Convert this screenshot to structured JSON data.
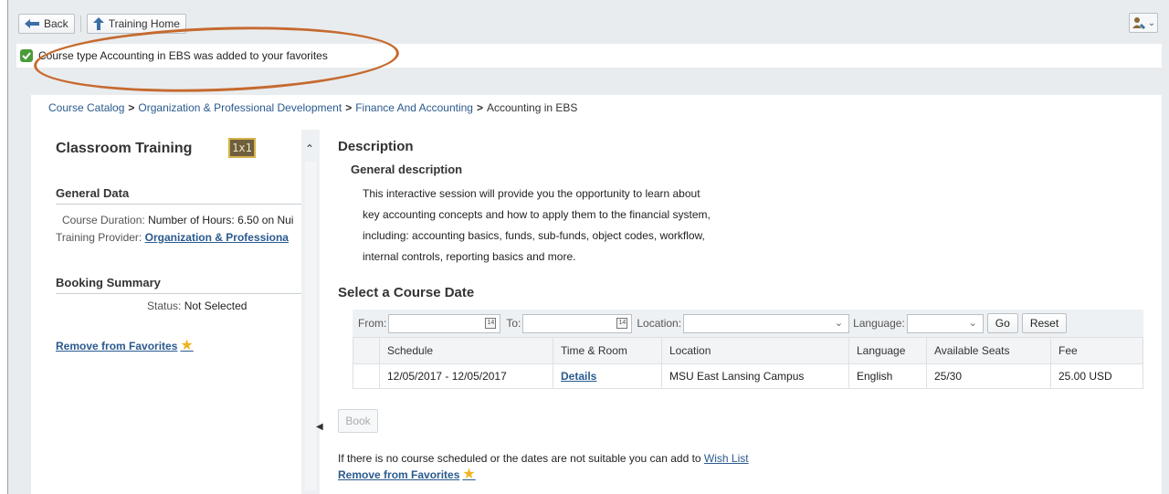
{
  "toolbar": {
    "back_label": "Back",
    "home_label": "Training Home"
  },
  "message": {
    "text": "Course type Accounting in EBS was added to your favorites",
    "status_color": "#4a9c3a"
  },
  "breadcrumb": {
    "items": [
      "Course Catalog",
      "Organization & Professional Development",
      "Finance And Accounting",
      "Accounting in EBS"
    ],
    "separator": ">"
  },
  "left": {
    "title": "Classroom Training",
    "badge": "1x1",
    "general_data": {
      "heading": "General Data",
      "duration_label": "Course Duration:",
      "duration_value": "Number of Hours: 6.50 on Nui",
      "provider_label": "Training Provider:",
      "provider_value": "Organization & Professiona"
    },
    "booking": {
      "heading": "Booking Summary",
      "status_label": "Status:",
      "status_value": "Not Selected"
    },
    "remove_fav": "Remove from Favorites"
  },
  "description": {
    "heading": "Description",
    "subheading": "General description",
    "lines": [
      "This interactive session will provide you the opportunity to learn about",
      "key accounting concepts and how to apply them to the financial system,",
      "including: accounting basics, funds, sub-funds, object codes, workflow,",
      "internal controls, reporting basics and more."
    ]
  },
  "course_date": {
    "heading": "Select a Course Date",
    "filters": {
      "from_label": "From:",
      "to_label": "To:",
      "location_label": "Location:",
      "language_label": "Language:",
      "cal_glyph": "14",
      "go_label": "Go",
      "reset_label": "Reset"
    },
    "columns": [
      "Schedule",
      "Time & Room",
      "Location",
      "Language",
      "Available Seats",
      "Fee"
    ],
    "rows": [
      {
        "schedule": "12/05/2017 - 12/05/2017",
        "time_room": "Details",
        "location": "MSU East Lansing Campus",
        "language": "English",
        "seats": "25/30",
        "fee": "25.00 USD"
      }
    ],
    "book_label": "Book",
    "wish_text": "If there is no course scheduled or the dates are not suitable you can add to ",
    "wish_link": "Wish List",
    "remove_fav": "Remove from Favorites"
  }
}
